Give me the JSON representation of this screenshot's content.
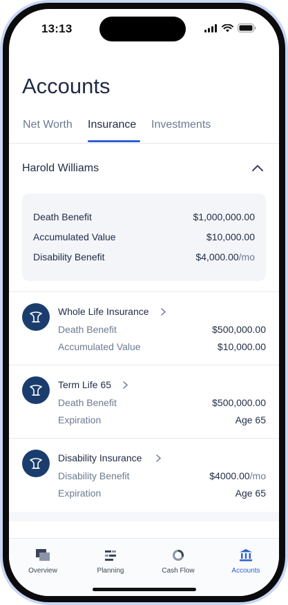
{
  "status_bar": {
    "time": "13:13"
  },
  "page": {
    "title": "Accounts"
  },
  "tabs": [
    {
      "label": "Net Worth",
      "active": false
    },
    {
      "label": "Insurance",
      "active": true
    },
    {
      "label": "Investments",
      "active": false
    }
  ],
  "insured": {
    "name": "Harold Williams",
    "summary": [
      {
        "label": "Death Benefit",
        "value": "$1,000,000.00",
        "unit": ""
      },
      {
        "label": "Accumulated Value",
        "value": "$10,000.00",
        "unit": ""
      },
      {
        "label": "Disability Benefit",
        "value": "$4,000.00",
        "unit": "/mo"
      }
    ]
  },
  "policies": [
    {
      "name": "Whole Life Insurance",
      "rows": [
        {
          "label": "Death Benefit",
          "value": "$500,000.00",
          "unit": ""
        },
        {
          "label": "Accumulated Value",
          "value": "$10,000.00",
          "unit": ""
        }
      ]
    },
    {
      "name": "Term Life 65",
      "rows": [
        {
          "label": "Death Benefit",
          "value": "$500,000.00",
          "unit": ""
        },
        {
          "label": "Expiration",
          "value": "Age 65",
          "unit": ""
        }
      ]
    },
    {
      "name": "Disability Insurance",
      "rows": [
        {
          "label": "Disability Benefit",
          "value": "$4000.00",
          "unit": "/mo"
        },
        {
          "label": "Expiration",
          "value": "Age 65",
          "unit": ""
        }
      ]
    }
  ],
  "tabbar": [
    {
      "label": "Overview",
      "icon": "overview-icon",
      "active": false
    },
    {
      "label": "Planning",
      "icon": "planning-icon",
      "active": false
    },
    {
      "label": "Cash Flow",
      "icon": "cash-flow-icon",
      "active": false
    },
    {
      "label": "Accounts",
      "icon": "bank-icon",
      "active": true
    }
  ],
  "colors": {
    "accent": "#2f5fd0",
    "navy": "#1b3d6e",
    "text": "#1f2a44",
    "muted": "#6b7a90"
  }
}
